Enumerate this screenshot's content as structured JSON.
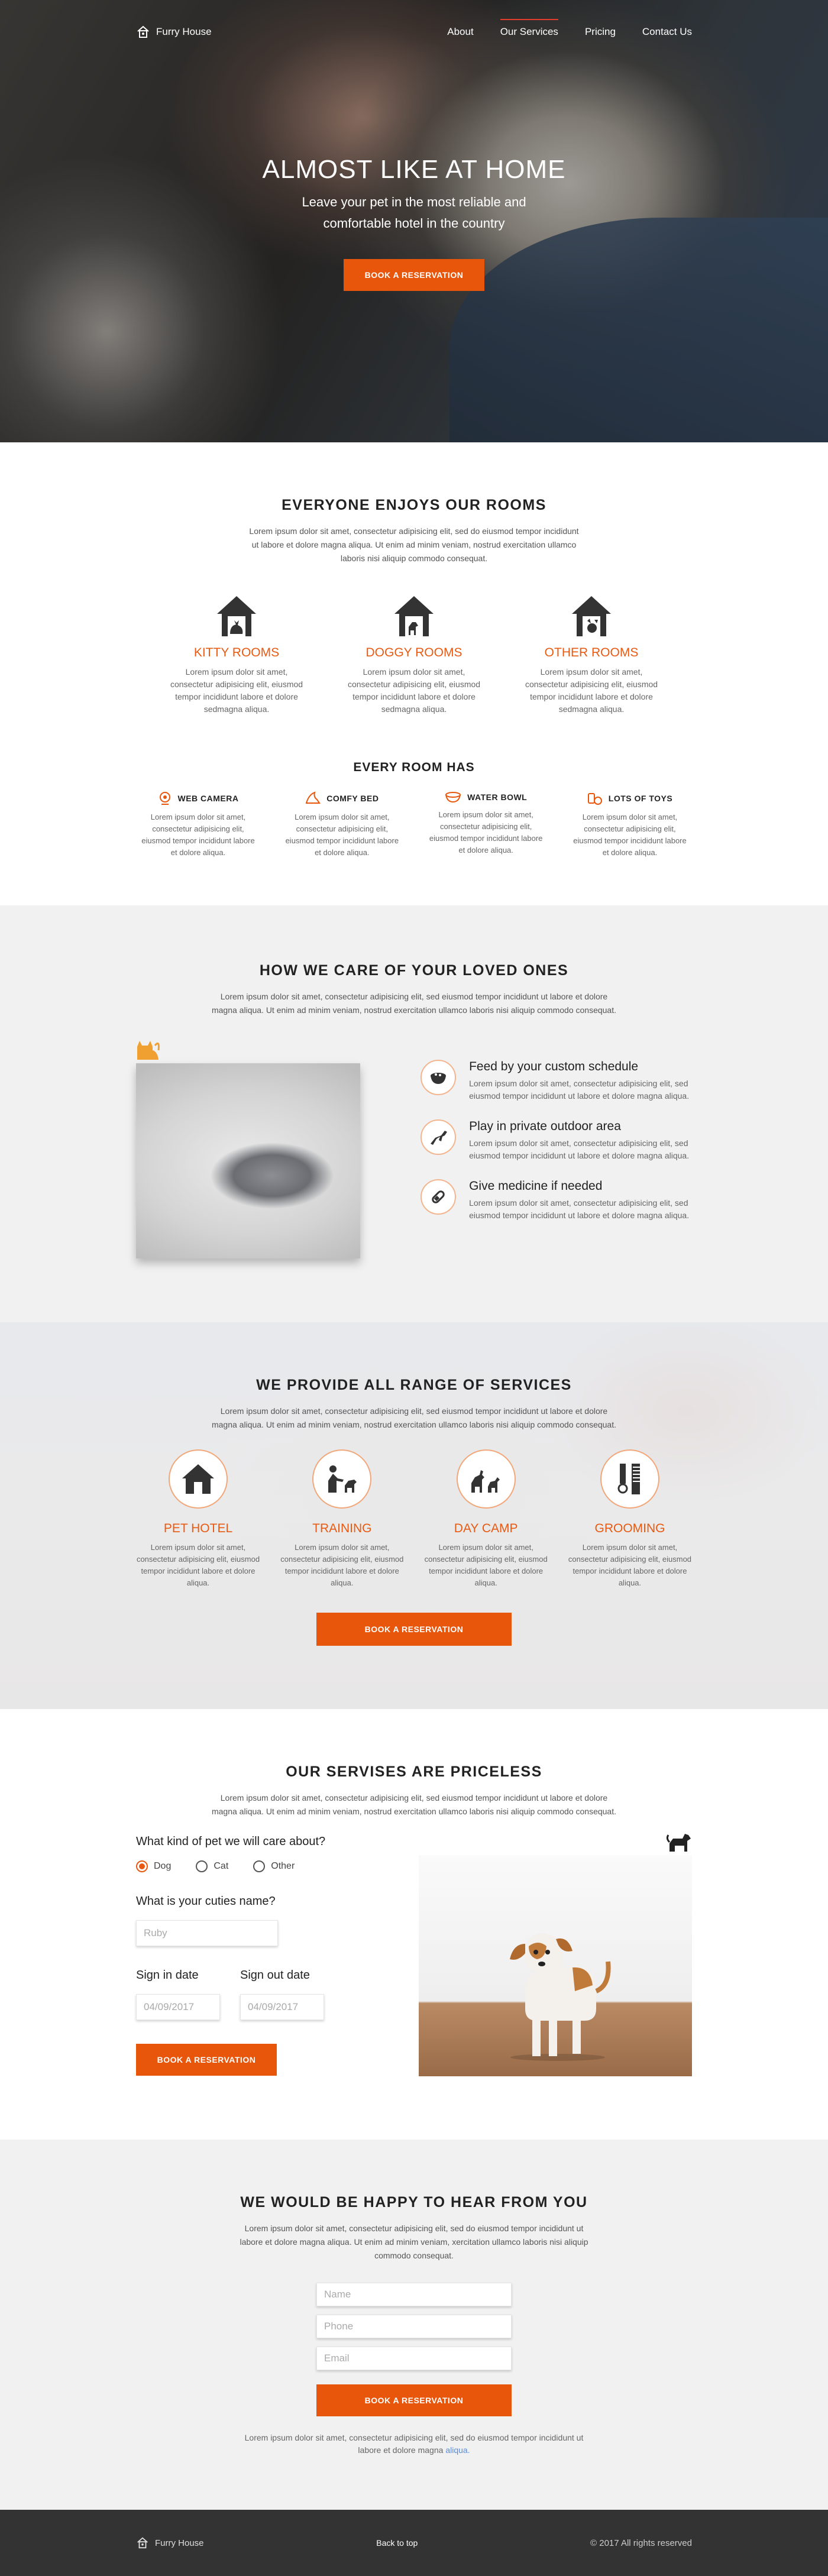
{
  "brand": {
    "name": "Furry House",
    "accent": "#e8560c"
  },
  "nav": {
    "items": [
      "About",
      "Our Services",
      "Pricing",
      "Contact Us"
    ],
    "active": "Our Services"
  },
  "hero": {
    "title": "ALMOST LIKE AT HOME",
    "subtitle_line1": "Leave your pet in the most reliable and",
    "subtitle_line2": "comfortable hotel in the country",
    "button": "BOOK A RESERVATION"
  },
  "rooms": {
    "title": "EVERYONE ENJOYS OUR ROOMS",
    "intro": "Lorem ipsum dolor sit amet, consectetur adipisicing elit, sed do eiusmod tempor incididunt ut labore et dolore magna aliqua. Ut enim ad minim veniam, nostrud exercitation ullamco laboris nisi aliquip commodo consequat.",
    "items": [
      {
        "title": "KITTY ROOMS",
        "text": "Lorem ipsum dolor sit amet, consectetur adipisicing elit, eiusmod tempor incididunt labore et dolore sedmagna aliqua.",
        "icon": "cat-house-icon"
      },
      {
        "title": "DOGGY ROOMS",
        "text": "Lorem ipsum dolor sit amet, consectetur adipisicing elit, eiusmod tempor incididunt labore et dolore sedmagna aliqua.",
        "icon": "dog-house-icon"
      },
      {
        "title": "OTHER ROOMS",
        "text": "Lorem ipsum dolor sit amet, consectetur adipisicing elit, eiusmod tempor incididunt labore et dolore sedmagna aliqua.",
        "icon": "pet-house-icon"
      }
    ],
    "has_title": "EVERY ROOM HAS",
    "features": [
      {
        "title": "WEB CAMERA",
        "text": "Lorem ipsum dolor sit amet, consectetur adipisicing elit, eiusmod tempor incididunt labore et dolore aliqua.",
        "icon": "webcam-icon"
      },
      {
        "title": "COMFY BED",
        "text": "Lorem ipsum dolor sit amet, consectetur adipisicing elit, eiusmod tempor incididunt labore et dolore aliqua.",
        "icon": "bed-icon"
      },
      {
        "title": "WATER BOWL",
        "text": "Lorem ipsum dolor sit amet, consectetur adipisicing elit, eiusmod tempor incididunt labore et dolore aliqua.",
        "icon": "bowl-icon"
      },
      {
        "title": "LOTS OF TOYS",
        "text": "Lorem ipsum dolor sit amet, consectetur adipisicing elit, eiusmod tempor incididunt labore et dolore aliqua.",
        "icon": "toys-icon"
      }
    ]
  },
  "care": {
    "title": "HOW WE CARE OF YOUR LOVED ONES",
    "intro": "Lorem ipsum dolor sit amet, consectetur adipisicing elit, sed eiusmod tempor incididunt ut labore et dolore magna aliqua. Ut enim ad minim veniam, nostrud exercitation ullamco laboris nisi aliquip commodo consequat.",
    "items": [
      {
        "title": "Feed by your custom schedule",
        "text": "Lorem ipsum dolor sit amet, consectetur adipisicing elit, sed eiusmod tempor incididunt ut labore et dolore magna aliqua.",
        "icon": "food-bowl-icon"
      },
      {
        "title": "Play in private outdoor area",
        "text": "Lorem ipsum dolor sit amet, consectetur adipisicing elit, sed eiusmod tempor incididunt ut labore et dolore magna aliqua.",
        "icon": "jumping-dog-icon"
      },
      {
        "title": "Give medicine if needed",
        "text": "Lorem ipsum dolor sit amet, consectetur adipisicing elit, sed eiusmod tempor incididunt ut labore et dolore magna aliqua.",
        "icon": "pill-icon"
      }
    ]
  },
  "services": {
    "title": "WE PROVIDE ALL RANGE OF SERVICES",
    "intro": "Lorem ipsum dolor sit amet, consectetur adipisicing elit, sed eiusmod tempor incididunt ut labore et dolore magna aliqua. Ut enim ad minim veniam, nostrud exercitation ullamco laboris nisi aliquip commodo consequat.",
    "items": [
      {
        "title": "PET HOTEL",
        "text": "Lorem ipsum dolor sit amet, consectetur adipisicing elit, eiusmod tempor incididunt labore et dolore aliqua.",
        "icon": "home-icon"
      },
      {
        "title": "TRAINING",
        "text": "Lorem ipsum dolor sit amet, consectetur adipisicing elit, eiusmod tempor incididunt labore et dolore aliqua.",
        "icon": "training-icon"
      },
      {
        "title": "DAY CAMP",
        "text": "Lorem ipsum dolor sit amet, consectetur adipisicing elit, eiusmod tempor incididunt labore et dolore aliqua.",
        "icon": "dogs-icon"
      },
      {
        "title": "GROOMING",
        "text": "Lorem ipsum dolor sit amet, consectetur adipisicing elit, eiusmod tempor incididunt labore et dolore aliqua.",
        "icon": "scissors-comb-icon"
      }
    ],
    "button": "BOOK A RESERVATION"
  },
  "pricing": {
    "title": "OUR SERVISES ARE PRICELESS",
    "intro": "Lorem ipsum dolor sit amet, consectetur adipisicing elit, sed eiusmod tempor incididunt ut labore et dolore magna aliqua. Ut enim ad minim veniam, nostrud exercitation ullamco laboris nisi aliquip commodo consequat.",
    "pet_question": "What kind of pet we will care about?",
    "pet_options": [
      "Dog",
      "Cat",
      "Other"
    ],
    "pet_selected": "Dog",
    "name_question": "What is your cuties name?",
    "name_placeholder": "Ruby",
    "sign_in_label": "Sign in date",
    "sign_in_placeholder": "04/09/2017",
    "sign_out_label": "Sign out date",
    "sign_out_placeholder": "04/09/2017",
    "button": "BOOK A RESERVATION"
  },
  "contact": {
    "title": "WE WOULD BE HAPPY TO HEAR FROM YOU",
    "intro": "Lorem ipsum dolor sit amet, consectetur adipisicing elit, sed do eiusmod tempor incididunt ut labore et dolore magna aliqua. Ut enim ad minim veniam, xercitation ullamco laboris nisi aliquip commodo consequat.",
    "name_placeholder": "Name",
    "phone_placeholder": "Phone",
    "email_placeholder": "Email",
    "button": "BOOK A RESERVATION",
    "note": "Lorem ipsum dolor sit amet, consectetur adipisicing elit, sed do eiusmod tempor incididunt ut labore et dolore magna",
    "note_link": "aliqua."
  },
  "footer": {
    "brand": "Furry House",
    "back_to_top": "Back to top",
    "copyright": "© 2017  All rights reserved"
  }
}
